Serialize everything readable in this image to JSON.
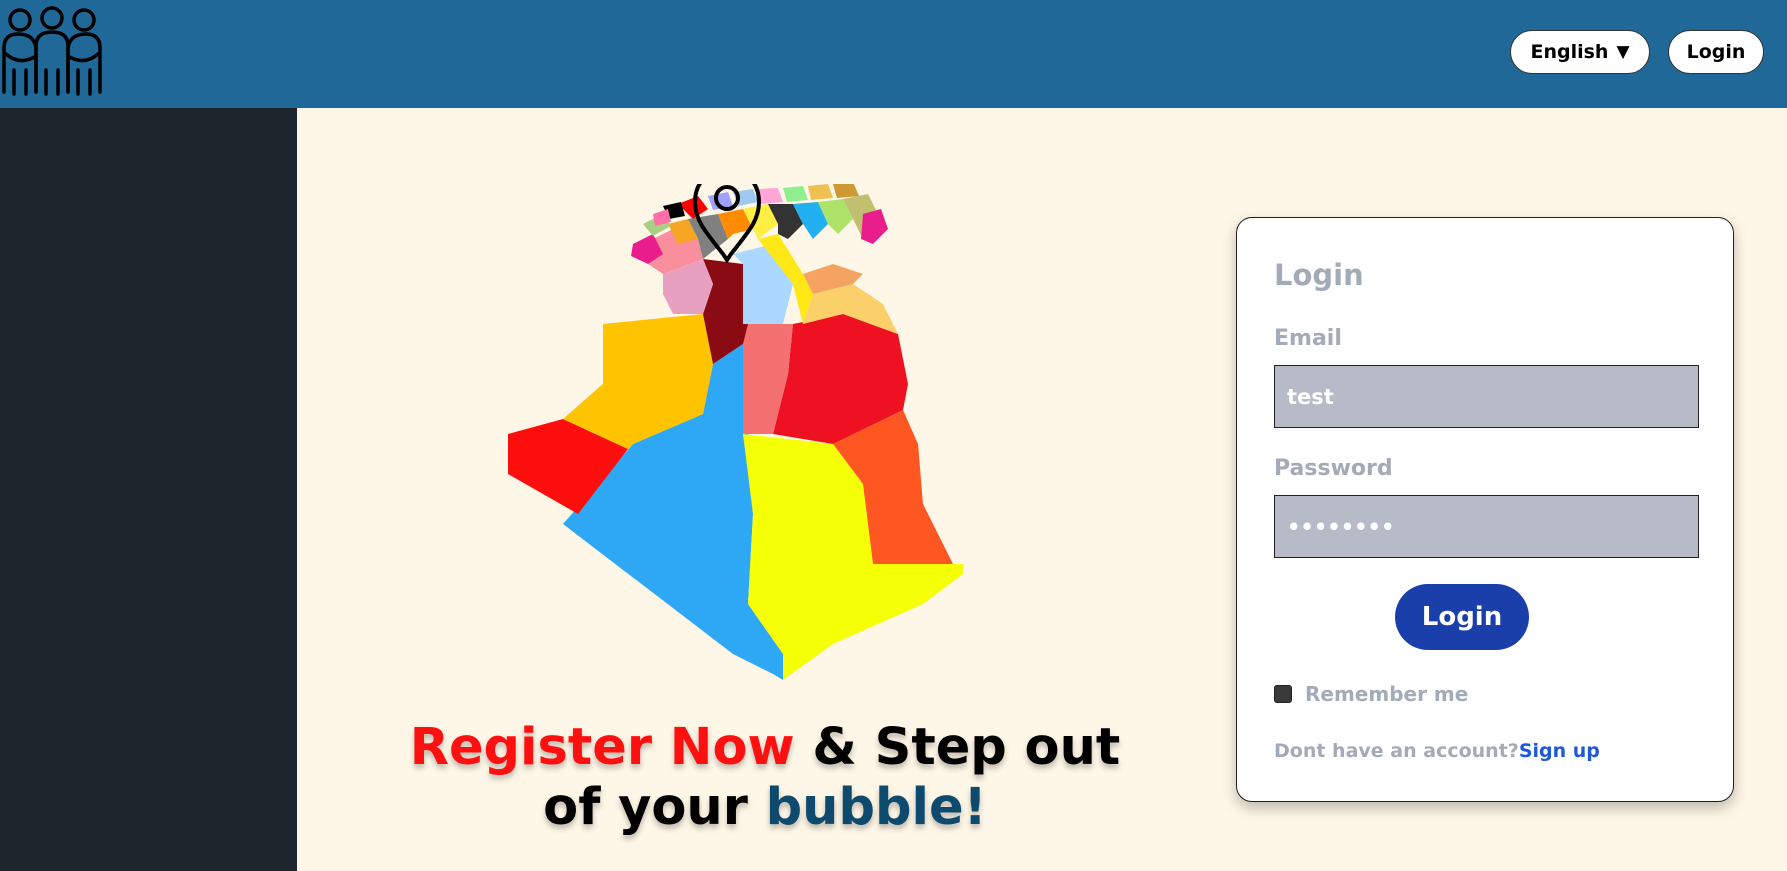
{
  "header": {
    "logo_icon": "people-group-icon",
    "language_label": "English",
    "language_caret": "▼",
    "login_label": "Login"
  },
  "hero": {
    "headline_part1": "Register Now",
    "headline_part2": " & Step out",
    "headline_part3": "of your ",
    "headline_part4": "bubble!",
    "map_icon": "algeria-map-icon",
    "pin_icon": "location-pin-icon"
  },
  "login_form": {
    "title": "Login",
    "email_label": "Email",
    "email_value": "test",
    "password_label": "Password",
    "password_value": "••••••••",
    "submit_label": "Login",
    "remember_label": "Remember me",
    "no_account_text": "Dont have an account?",
    "signup_label": "Sign up"
  },
  "colors": {
    "topbar": "#1f6898",
    "sidebar": "#1e252d",
    "background": "#fef6e6",
    "accent_red": "#ff1010",
    "accent_blue": "#0e4a6e",
    "button_blue": "#1b3faa",
    "link_blue": "#1c58d8"
  }
}
